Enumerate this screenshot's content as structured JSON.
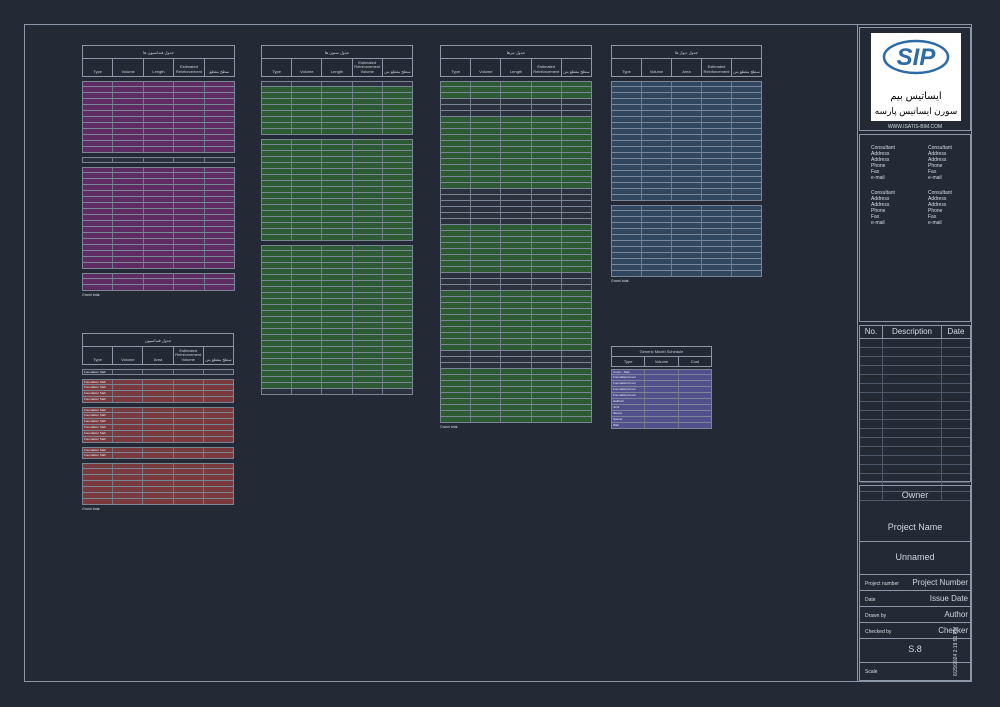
{
  "schedules": {
    "s1": {
      "title": "جدول فنداسیون ها",
      "cols": [
        "Type",
        "Volume",
        "Length",
        "Estimated Reinforcement",
        "سطح مقطع"
      ]
    },
    "s2": {
      "title": "جدول ستون ها",
      "cols": [
        "Type",
        "Volume",
        "Length",
        "Estimated Reinforcement Volume",
        "سطح مقطع بتن"
      ]
    },
    "s3": {
      "title": "جدول تیرها",
      "cols": [
        "Type",
        "Volume",
        "Length",
        "Estimated Reinforcement",
        "سطح مقطع بتن"
      ]
    },
    "s4": {
      "title": "جدول دیوار ها",
      "cols": [
        "Type",
        "Volume",
        "Area",
        "Estimated Reinforcement",
        "سطح مقطع بتن"
      ]
    },
    "s5": {
      "title": "جدول فنداسیون",
      "cols": [
        "Type",
        "Volume",
        "Area",
        "Estimated Reinforcement Volume",
        "سطح مقطع بتن"
      ]
    },
    "s6": {
      "title": "Generic Model Schedule",
      "cols": [
        "Type",
        "Volume",
        "Cost"
      ]
    }
  },
  "s5_groups": [
    "Foundation Slab",
    "Foundation Slab",
    "Foundation Slab",
    "Pile"
  ],
  "s5_rowlabels": [
    "Foundation Slab",
    "Foundation Slab",
    "Foundation Slab",
    "Foundation Slab",
    "Foundation Slab",
    "Foundation Slab",
    "Foundation Slab",
    "Foundation Slab"
  ],
  "s6_rows": [
    "Cover - Slab",
    "FoundationCover",
    "FoundationCover",
    "FoundationCover",
    "FoundationCover",
    "HalfCell",
    "Joint",
    "Sleeve",
    "Spacer",
    "Wall"
  ],
  "grand_total": "Grand total:",
  "titleblock": {
    "logo_letters": "SIP",
    "logo_fa1": "ایساتیس بیم",
    "logo_fa2": "سورن ایساتیس پارسه",
    "website": "WWW.ISATIS-BIM.COM",
    "consultant": [
      "Consultant",
      "Address",
      "Address",
      "Phone",
      "Fax",
      "e-mail"
    ],
    "rev_headers": [
      "No.",
      "Description",
      "Date"
    ],
    "owner": "Owner",
    "project_name": "Project Name",
    "unnamed": "Unnamed",
    "project_number_label": "Project number",
    "project_number": "Project Number",
    "date_label": "Date",
    "issue_date": "Issue Date",
    "drawn_by_label": "Drawn by",
    "author": "Author",
    "checked_by_label": "Checked by",
    "checker": "Checker",
    "sheet_number": "S.8",
    "scale_label": "Scale",
    "timestamp": "6/29/2024 2:19:51 PM"
  },
  "colors": {
    "magenta": "#5e2b63",
    "green": "#2c5a33",
    "blue": "#31465f",
    "red": "#7a3a3d",
    "purple": "#52508c",
    "dark": "#2b323e"
  }
}
